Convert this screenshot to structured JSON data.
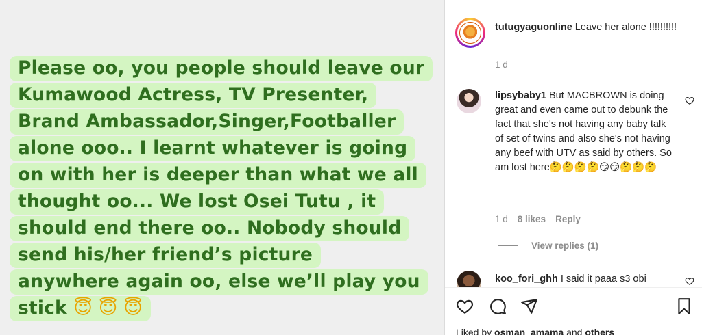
{
  "post": {
    "caption_lines": [
      "Please oo, you people should leave our",
      "Kumawood Actress, TV Presenter,",
      "Brand Ambassador,Singer,Footballer",
      "alone ooo.. I learnt whatever is going",
      "on with her is deeper than what we all",
      "thought oo... We lost Osei Tutu , it",
      "should end there oo.. Nobody should",
      "send his/her friend’s picture",
      "anywhere again oo, else we’ll play you",
      "stick"
    ],
    "caption_emojis": "😇 😇 😇",
    "highlight_color": "#d4f5c2",
    "text_color": "#2f6e1f"
  },
  "comments": [
    {
      "username": "tutugyaguonline",
      "text": "Leave her alone !!!!!!!!!!",
      "time": "1 d"
    },
    {
      "username": "lipsybaby1",
      "text": "But MACBROWN is doing great and even came out to debunk the fact that she's not having any baby talk of set of twins and also she's not having any beef with UTV as said by others. So am lost here🤔🤔🤔🤔😏😏🤔🤔🤔",
      "time": "1 d",
      "likes": "8 likes",
      "reply_label": "Reply",
      "view_replies": "View replies (1)"
    },
    {
      "username": "koo_fori_ghh",
      "text": "I said it paaa s3 obi"
    }
  ],
  "liked_by": {
    "prefix": "Liked by",
    "user": "osman_amama",
    "middle": "and",
    "others": "others"
  }
}
